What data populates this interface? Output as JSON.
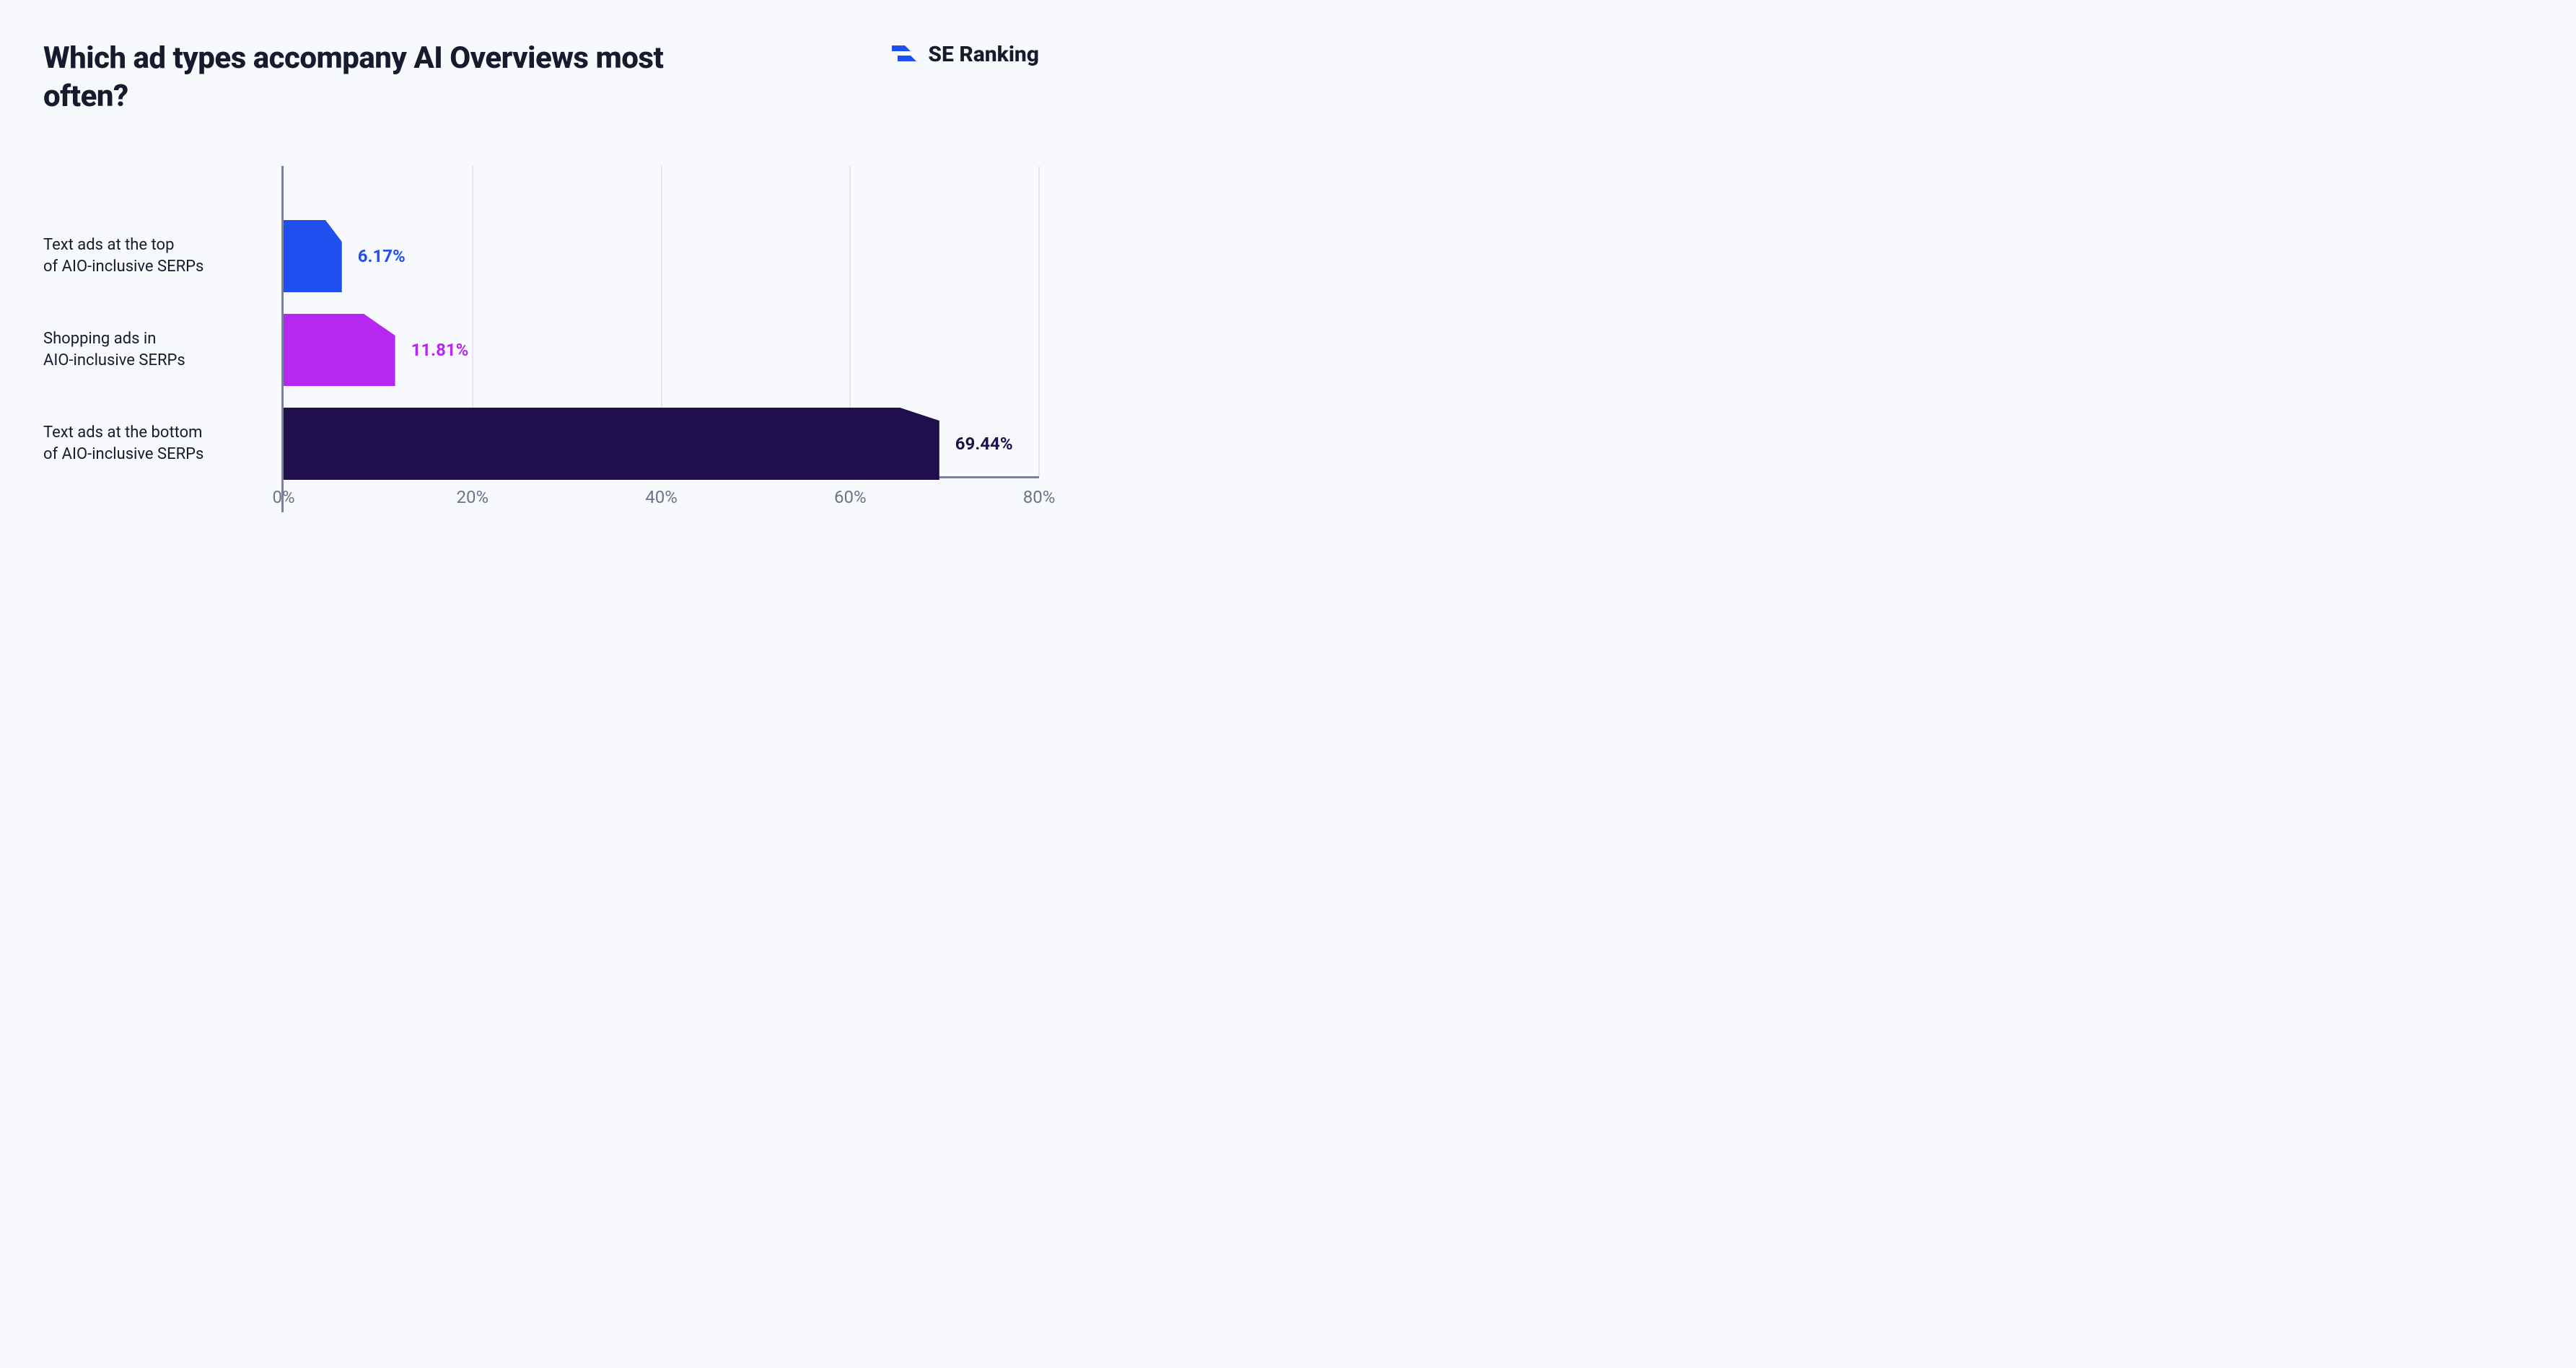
{
  "header": {
    "title": "Which ad types accompany AI Overviews most often?",
    "brand": "SE Ranking"
  },
  "chart_data": {
    "type": "bar",
    "orientation": "horizontal",
    "xlabel": "",
    "ylabel": "",
    "xlim": [
      0,
      80
    ],
    "x_ticks": [
      "0%",
      "20%",
      "40%",
      "60%",
      "80%"
    ],
    "categories": [
      "Text ads at the top of AIO-inclusive SERPs",
      "Shopping ads in AIO-inclusive SERPs",
      "Text ads at the bottom of AIO-inclusive SERPs"
    ],
    "values": [
      6.17,
      11.81,
      69.44
    ],
    "value_labels": [
      "6.17%",
      "11.81%",
      "69.44%"
    ],
    "colors": [
      "#1f4fee",
      "#b628f2",
      "#1f0f4d"
    ]
  }
}
